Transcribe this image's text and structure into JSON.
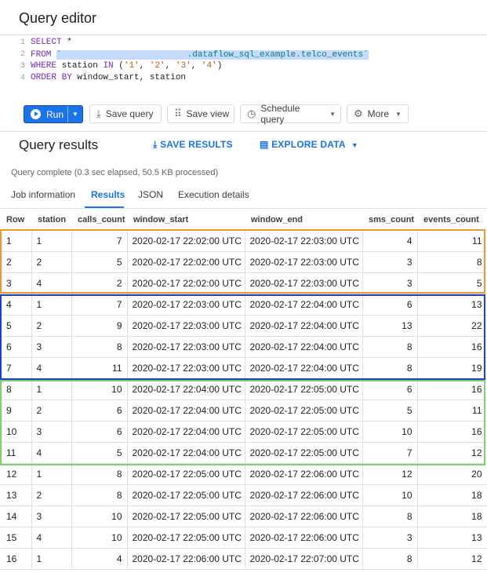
{
  "editor": {
    "title": "Query editor",
    "line_numbers": [
      "1",
      "2",
      "3",
      "4"
    ],
    "line1": {
      "kw": "SELECT",
      "rest": " *"
    },
    "line2": {
      "kw": "FROM",
      "pad": " ",
      "tick_open": "`",
      "table": ".dataflow_sql_example.telco_events",
      "tick_close": "`"
    },
    "line3": {
      "kw1": "WHERE",
      "mid": " station ",
      "kw2": "IN",
      "vals_open": " (",
      "v1": "'1'",
      "c1": ", ",
      "v2": "'2'",
      "c2": ", ",
      "v3": "'3'",
      "c3": ", ",
      "v4": "'4'",
      "vals_close": ")"
    },
    "line4": {
      "kw": "ORDER BY",
      "rest": " window_start, station"
    }
  },
  "toolbar": {
    "run_label": "Run",
    "save_query_label": "Save query",
    "save_view_label": "Save view",
    "schedule_query_label": "Schedule query",
    "more_label": "More"
  },
  "results": {
    "title": "Query results",
    "save_results_label": "SAVE RESULTS",
    "explore_data_label": "EXPLORE DATA",
    "status": "Query complete (0.3 sec elapsed, 50.5 KB processed)",
    "tabs": [
      "Job information",
      "Results",
      "JSON",
      "Execution details"
    ],
    "active_tab": "Results"
  },
  "table": {
    "columns": [
      "Row",
      "station",
      "calls_count",
      "window_start",
      "window_end",
      "sms_count",
      "events_count"
    ],
    "rows": [
      [
        "1",
        "1",
        "7",
        "2020-02-17 22:02:00 UTC",
        "2020-02-17 22:03:00 UTC",
        "4",
        "11"
      ],
      [
        "2",
        "2",
        "5",
        "2020-02-17 22:02:00 UTC",
        "2020-02-17 22:03:00 UTC",
        "3",
        "8"
      ],
      [
        "3",
        "4",
        "2",
        "2020-02-17 22:02:00 UTC",
        "2020-02-17 22:03:00 UTC",
        "3",
        "5"
      ],
      [
        "4",
        "1",
        "7",
        "2020-02-17 22:03:00 UTC",
        "2020-02-17 22:04:00 UTC",
        "6",
        "13"
      ],
      [
        "5",
        "2",
        "9",
        "2020-02-17 22:03:00 UTC",
        "2020-02-17 22:04:00 UTC",
        "13",
        "22"
      ],
      [
        "6",
        "3",
        "8",
        "2020-02-17 22:03:00 UTC",
        "2020-02-17 22:04:00 UTC",
        "8",
        "16"
      ],
      [
        "7",
        "4",
        "11",
        "2020-02-17 22:03:00 UTC",
        "2020-02-17 22:04:00 UTC",
        "8",
        "19"
      ],
      [
        "8",
        "1",
        "10",
        "2020-02-17 22:04:00 UTC",
        "2020-02-17 22:05:00 UTC",
        "6",
        "16"
      ],
      [
        "9",
        "2",
        "6",
        "2020-02-17 22:04:00 UTC",
        "2020-02-17 22:05:00 UTC",
        "5",
        "11"
      ],
      [
        "10",
        "3",
        "6",
        "2020-02-17 22:04:00 UTC",
        "2020-02-17 22:05:00 UTC",
        "10",
        "16"
      ],
      [
        "11",
        "4",
        "5",
        "2020-02-17 22:04:00 UTC",
        "2020-02-17 22:05:00 UTC",
        "7",
        "12"
      ],
      [
        "12",
        "1",
        "8",
        "2020-02-17 22:05:00 UTC",
        "2020-02-17 22:06:00 UTC",
        "12",
        "20"
      ],
      [
        "13",
        "2",
        "8",
        "2020-02-17 22:05:00 UTC",
        "2020-02-17 22:06:00 UTC",
        "10",
        "18"
      ],
      [
        "14",
        "3",
        "10",
        "2020-02-17 22:05:00 UTC",
        "2020-02-17 22:06:00 UTC",
        "8",
        "18"
      ],
      [
        "15",
        "4",
        "10",
        "2020-02-17 22:05:00 UTC",
        "2020-02-17 22:06:00 UTC",
        "3",
        "13"
      ],
      [
        "16",
        "1",
        "4",
        "2020-02-17 22:06:00 UTC",
        "2020-02-17 22:07:00 UTC",
        "8",
        "12"
      ]
    ]
  },
  "colors": {
    "accent": "#1a73e8",
    "group_1_outline": "#f0962e",
    "group_2_outline": "#1a3fd6",
    "group_3_outline": "#7fd16b"
  },
  "icons": {
    "run": "play-circle-icon",
    "save_query": "save-upload-icon",
    "save_view": "grid-dots-icon",
    "schedule": "clock-icon",
    "more": "gear-icon",
    "save_results": "download-icon",
    "explore": "bar-chart-icon"
  }
}
